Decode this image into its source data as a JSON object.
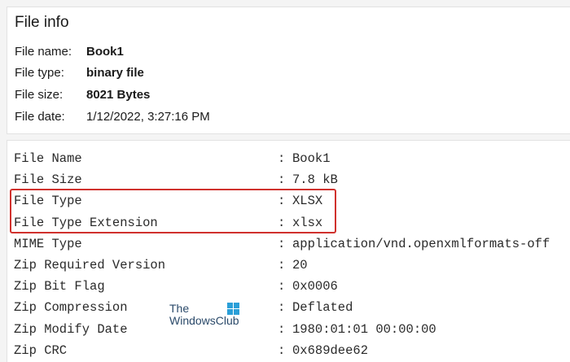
{
  "file_info": {
    "title": "File info",
    "rows": [
      {
        "label": "File name:",
        "value": "Book1"
      },
      {
        "label": "File type:",
        "value": "binary file"
      },
      {
        "label": "File size:",
        "value": "8021 Bytes"
      },
      {
        "label": "File date:",
        "value": "1/12/2022, 3:27:16 PM"
      }
    ]
  },
  "metadata": {
    "separator": ":",
    "rows": [
      {
        "key": "File Name",
        "value": "Book1"
      },
      {
        "key": "File Size",
        "value": "7.8 kB"
      },
      {
        "key": "File Type",
        "value": "XLSX"
      },
      {
        "key": "File Type Extension",
        "value": "xlsx"
      },
      {
        "key": "MIME Type",
        "value": "application/vnd.openxmlformats-off"
      },
      {
        "key": "Zip Required Version",
        "value": "20"
      },
      {
        "key": "Zip Bit Flag",
        "value": "0x0006"
      },
      {
        "key": "Zip Compression",
        "value": "Deflated"
      },
      {
        "key": "Zip Modify Date",
        "value": "1980:01:01 00:00:00"
      },
      {
        "key": "Zip CRC",
        "value": "0x689dee62"
      }
    ]
  },
  "highlight_color": "#d0312d",
  "watermark": {
    "line1": "The",
    "line2": "WindowsClub",
    "logo": "windows-logo-icon"
  }
}
